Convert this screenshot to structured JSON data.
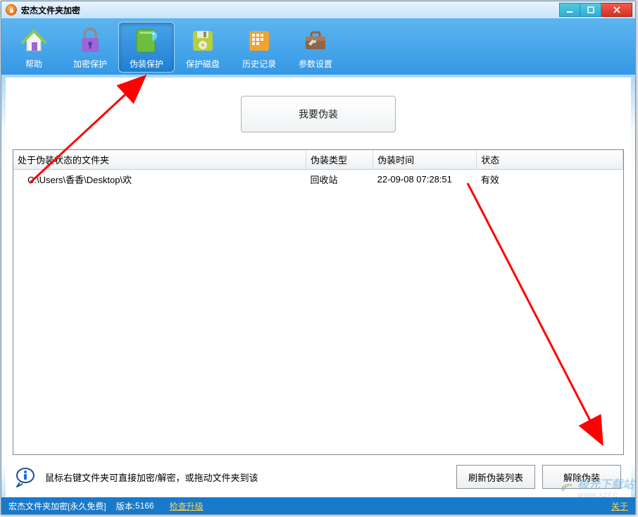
{
  "window": {
    "title": "宏杰文件夹加密"
  },
  "toolbar": {
    "items": [
      {
        "id": "help",
        "label": "帮助"
      },
      {
        "id": "encrypt-protect",
        "label": "加密保护"
      },
      {
        "id": "disguise-protect",
        "label": "伪装保护"
      },
      {
        "id": "protect-disk",
        "label": "保护磁盘"
      },
      {
        "id": "history",
        "label": "历史记录"
      },
      {
        "id": "settings",
        "label": "参数设置"
      }
    ],
    "active_index": 2
  },
  "primary_action": {
    "label": "我要伪装"
  },
  "table": {
    "columns": [
      "处于伪装状态的文件夹",
      "伪装类型",
      "伪装时间",
      "状态"
    ],
    "rows": [
      {
        "path": "C:\\Users\\香香\\Desktop\\欢",
        "type": "回收站",
        "time": "22-09-08 07:28:51",
        "status": "有效"
      }
    ]
  },
  "hint": {
    "text": "鼠标右键文件夹可直接加密/解密，或拖动文件夹到该"
  },
  "actions": {
    "refresh": "刷新伪装列表",
    "remove": "解除伪装"
  },
  "statusbar": {
    "product": "宏杰文件夹加密[永久免费]",
    "version_label": "版本:",
    "version": "5166",
    "check_update": "检查升级",
    "about": "关于"
  },
  "watermark": {
    "main": "极光下载站",
    "sub": "WWW.XZ7.C"
  },
  "colors": {
    "accent": "#3598e5",
    "status_bg": "#1979ca",
    "arrow": "#ff0000"
  }
}
